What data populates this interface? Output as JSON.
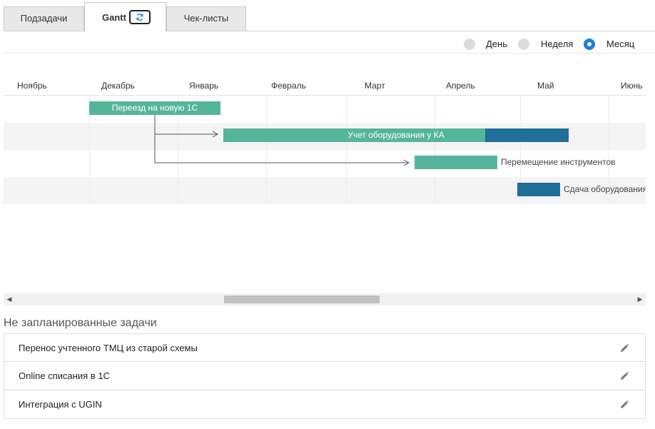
{
  "tabs": [
    {
      "label": "Подзадачи"
    },
    {
      "label": "Gantt",
      "active": true
    },
    {
      "label": "Чек-листы"
    }
  ],
  "view_modes": [
    {
      "label": "День",
      "checked": false
    },
    {
      "label": "Неделя",
      "checked": false
    },
    {
      "label": "Месяц",
      "checked": true
    }
  ],
  "gantt": {
    "months": [
      "Ноябрь",
      "Декабрь",
      "Январь",
      "Февраль",
      "Март",
      "Апрель",
      "Май",
      "Июнь"
    ],
    "tasks": [
      {
        "name": "Переезд на новую 1С",
        "label_position": "inside"
      },
      {
        "name": "Учет оборудования у КА",
        "label_position": "inside"
      },
      {
        "name": "Перемещение инструментов",
        "label_position": "outside"
      },
      {
        "name": "Сдача оборудования",
        "label_position": "outside"
      }
    ],
    "colors": {
      "planned": "#55b59a",
      "progress": "#1f6f99"
    }
  },
  "unplanned": {
    "title": "Не запланированные задачи",
    "items": [
      {
        "text": "Перенос учтенного ТМЦ из старой схемы"
      },
      {
        "text": "Online списания в 1С"
      },
      {
        "text": "Интеграция с UGIN"
      }
    ]
  }
}
